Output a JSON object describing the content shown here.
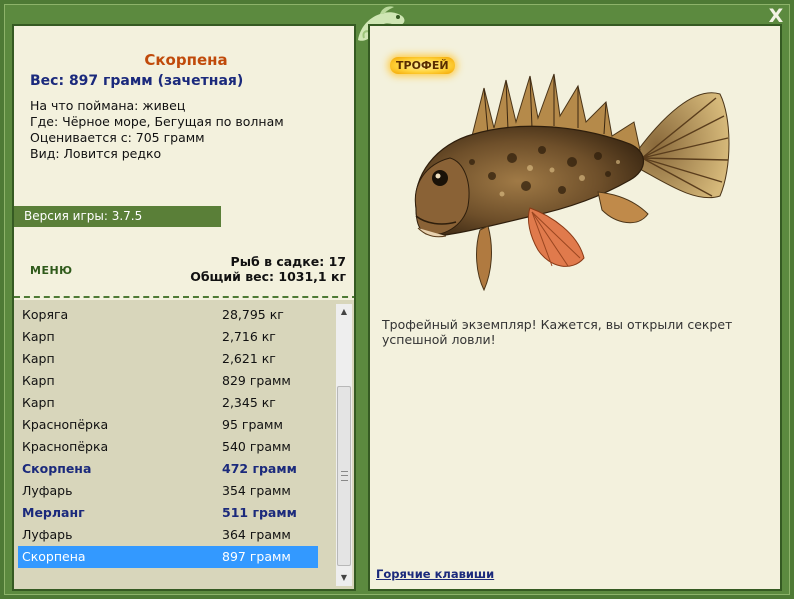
{
  "window": {
    "close_label": "X"
  },
  "fish": {
    "title": "Скорпена",
    "weight_line": "Вес: 897 грамм (зачетная)",
    "details": [
      "На что поймана: живец",
      "Где: Чёрное море, Бегущая по волнам",
      "Оценивается с: 705 грамм",
      "Вид: Ловится редко"
    ]
  },
  "version": "Версия игры: 3.7.5",
  "menu_label": "МЕНЮ",
  "stats": {
    "fish_count": "Рыб в садке: 17",
    "total_weight": "Общий вес: 1031,1 кг"
  },
  "catch_list": [
    {
      "name": "Коряга",
      "weight": "28,795 кг",
      "highlight": false,
      "selected": false
    },
    {
      "name": "Карп",
      "weight": "2,716 кг",
      "highlight": false,
      "selected": false
    },
    {
      "name": "Карп",
      "weight": "2,621 кг",
      "highlight": false,
      "selected": false
    },
    {
      "name": "Карп",
      "weight": "829 грамм",
      "highlight": false,
      "selected": false
    },
    {
      "name": "Карп",
      "weight": "2,345 кг",
      "highlight": false,
      "selected": false
    },
    {
      "name": "Краснопёрка",
      "weight": "95 грамм",
      "highlight": false,
      "selected": false
    },
    {
      "name": "Краснопёрка",
      "weight": "540 грамм",
      "highlight": false,
      "selected": false
    },
    {
      "name": "Скорпена",
      "weight": "472 грамм",
      "highlight": true,
      "selected": false
    },
    {
      "name": "Луфарь",
      "weight": "354 грамм",
      "highlight": false,
      "selected": false
    },
    {
      "name": "Мерланг",
      "weight": "511 грамм",
      "highlight": true,
      "selected": false
    },
    {
      "name": "Луфарь",
      "weight": "364 грамм",
      "highlight": false,
      "selected": false
    },
    {
      "name": "Скорпена",
      "weight": "897 грамм",
      "highlight": false,
      "selected": true
    }
  ],
  "trophy": {
    "badge": "ТРОФЕЙ",
    "text": "Трофейный экземпляр! Кажется, вы открыли секрет успешной ловли!"
  },
  "hotkeys_label": "Горячие клавиши",
  "colors": {
    "frame": "#4e7a35",
    "panel": "#f3f1dd",
    "title": "#c04a0a",
    "accent_blue": "#1b2a7c",
    "selection": "#3399ff"
  },
  "icons": [
    "close-icon",
    "chameleon-logo-icon",
    "scroll-up-icon",
    "scroll-down-icon"
  ]
}
